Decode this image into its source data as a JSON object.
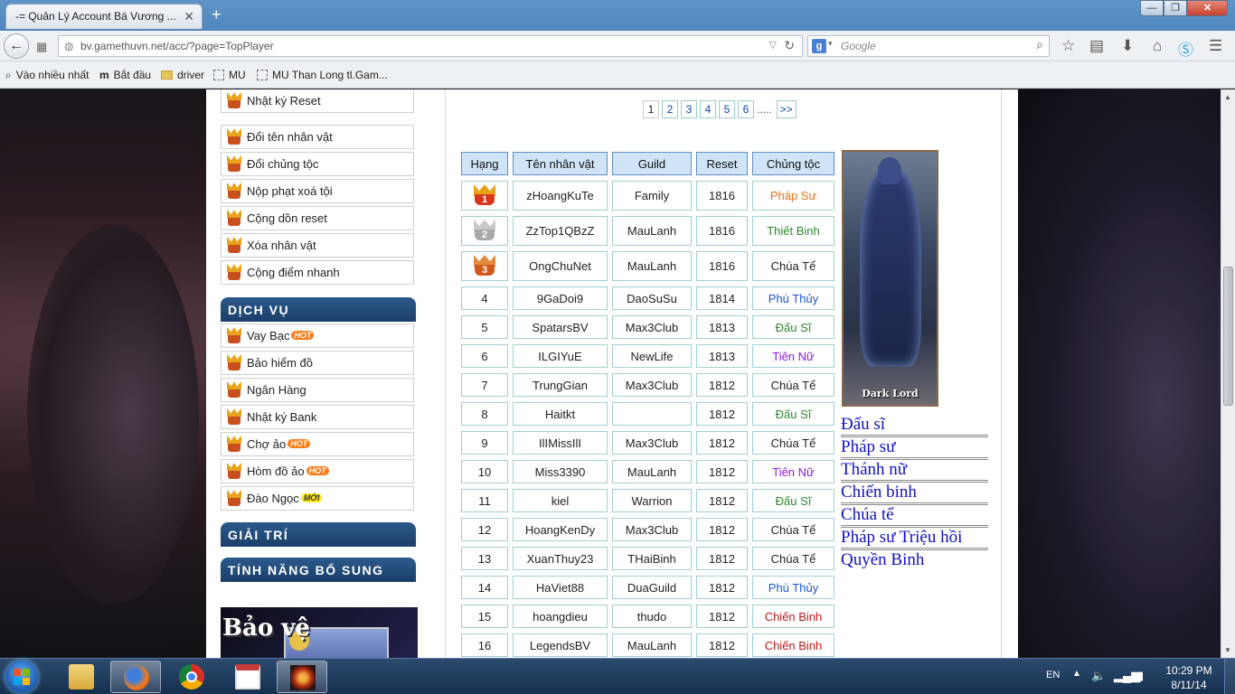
{
  "browser": {
    "tab_title": "-= Quản Lý Account Bá Vương ...",
    "url": "bv.gamethuvn.net/acc/?page=TopPlayer",
    "search_placeholder": "Google",
    "bookmarks": [
      "Vào nhiều nhất",
      "Bắt đầu",
      "driver",
      "MU",
      "MU Than Long tl.Gam..."
    ]
  },
  "sidebar": {
    "account_items": [
      {
        "label": "Nhật ký Reset"
      },
      {
        "label": "Đổi tên nhân vật"
      },
      {
        "label": "Đổi chủng tộc"
      },
      {
        "label": "Nộp phạt xoá tội"
      },
      {
        "label": "Cộng dồn reset"
      },
      {
        "label": "Xóa nhân vật"
      },
      {
        "label": "Cộng điểm nhanh"
      }
    ],
    "section_services": "DỊCH VỤ",
    "service_items": [
      {
        "label": "Vay Bạc",
        "badge": "HOT"
      },
      {
        "label": "Bảo hiểm đồ",
        "badge": ""
      },
      {
        "label": "Ngân Hàng",
        "badge": ""
      },
      {
        "label": "Nhật ký Bank",
        "badge": ""
      },
      {
        "label": "Chợ ảo",
        "badge": "HOT"
      },
      {
        "label": "Hòm đồ ảo",
        "badge": "HOT"
      },
      {
        "label": "Đào Ngọc",
        "badge": "MỚI"
      }
    ],
    "section_entertainment": "GIẢI TRÍ",
    "section_features": "TÍNH NĂNG BỔ SUNG",
    "promo_text": "Bảo vệ"
  },
  "pager": {
    "pages": [
      "1",
      "2",
      "3",
      "4",
      "5",
      "6"
    ],
    "current": "1",
    "dots": ".....",
    "next": ">>"
  },
  "table": {
    "headers": [
      "Hạng",
      "Tên nhân vật",
      "Guild",
      "Reset",
      "Chủng tộc"
    ],
    "rows": [
      {
        "rank": "1",
        "name": "zHoangKuTe",
        "guild": "Family",
        "reset": "1816",
        "race": "Pháp Sư",
        "race_color": "#e8701c"
      },
      {
        "rank": "2",
        "name": "ZzTop1QBzZ",
        "guild": "MauLanh",
        "reset": "1816",
        "race": "Thiết Binh",
        "race_color": "#2a8a2a"
      },
      {
        "rank": "3",
        "name": "OngChuNet",
        "guild": "MauLanh",
        "reset": "1816",
        "race": "Chúa Tể",
        "race_color": "#222222"
      },
      {
        "rank": "4",
        "name": "9GaDoi9",
        "guild": "DaoSuSu",
        "reset": "1814",
        "race": "Phù Thủy",
        "race_color": "#1a55d8"
      },
      {
        "rank": "5",
        "name": "SpatarsBV",
        "guild": "Max3Club",
        "reset": "1813",
        "race": "Đấu Sĩ",
        "race_color": "#2a8a2a"
      },
      {
        "rank": "6",
        "name": "ILGIYuE",
        "guild": "NewLife",
        "reset": "1813",
        "race": "Tiên Nữ",
        "race_color": "#8a1ae0"
      },
      {
        "rank": "7",
        "name": "TrungGian",
        "guild": "Max3Club",
        "reset": "1812",
        "race": "Chúa Tể",
        "race_color": "#222222"
      },
      {
        "rank": "8",
        "name": "Haitkt",
        "guild": "",
        "reset": "1812",
        "race": "Đấu Sĩ",
        "race_color": "#2a8a2a"
      },
      {
        "rank": "9",
        "name": "IlIMissIlI",
        "guild": "Max3Club",
        "reset": "1812",
        "race": "Chúa Tể",
        "race_color": "#222222"
      },
      {
        "rank": "10",
        "name": "Miss3390",
        "guild": "MauLanh",
        "reset": "1812",
        "race": "Tiên Nữ",
        "race_color": "#8a1ae0"
      },
      {
        "rank": "11",
        "name": "kiel",
        "guild": "Warrion",
        "reset": "1812",
        "race": "Đấu Sĩ",
        "race_color": "#2a8a2a"
      },
      {
        "rank": "12",
        "name": "HoangKenDy",
        "guild": "Max3Club",
        "reset": "1812",
        "race": "Chúa Tể",
        "race_color": "#222222"
      },
      {
        "rank": "13",
        "name": "XuanThuy23",
        "guild": "THaiBinh",
        "reset": "1812",
        "race": "Chúa Tể",
        "race_color": "#222222"
      },
      {
        "rank": "14",
        "name": "HaViet88",
        "guild": "DuaGuild",
        "reset": "1812",
        "race": "Phù Thủy",
        "race_color": "#1a55d8"
      },
      {
        "rank": "15",
        "name": "hoangdieu",
        "guild": "thudo",
        "reset": "1812",
        "race": "Chiến Binh",
        "race_color": "#c01818"
      },
      {
        "rank": "16",
        "name": "LegendsBV",
        "guild": "MauLanh",
        "reset": "1812",
        "race": "Chiến Binh",
        "race_color": "#c01818"
      }
    ]
  },
  "hero": {
    "label": "Dark Lord"
  },
  "classes": [
    "Đấu sĩ",
    "Pháp sư",
    "Thánh nữ",
    "Chiến binh",
    "Chúa tể",
    "Pháp sư Triệu hồi",
    "Quyền Binh"
  ],
  "taskbar": {
    "lang": "EN",
    "time": "10:29 PM",
    "date": "8/11/14"
  },
  "colors": {
    "section_head": "#1b3f69",
    "header_cell": "#cfe4f7",
    "class_link": "#1010c8",
    "medal_gold": "#e8a21b",
    "medal_silver": "#c9c9c9",
    "medal_bronze": "#e48a3c"
  }
}
